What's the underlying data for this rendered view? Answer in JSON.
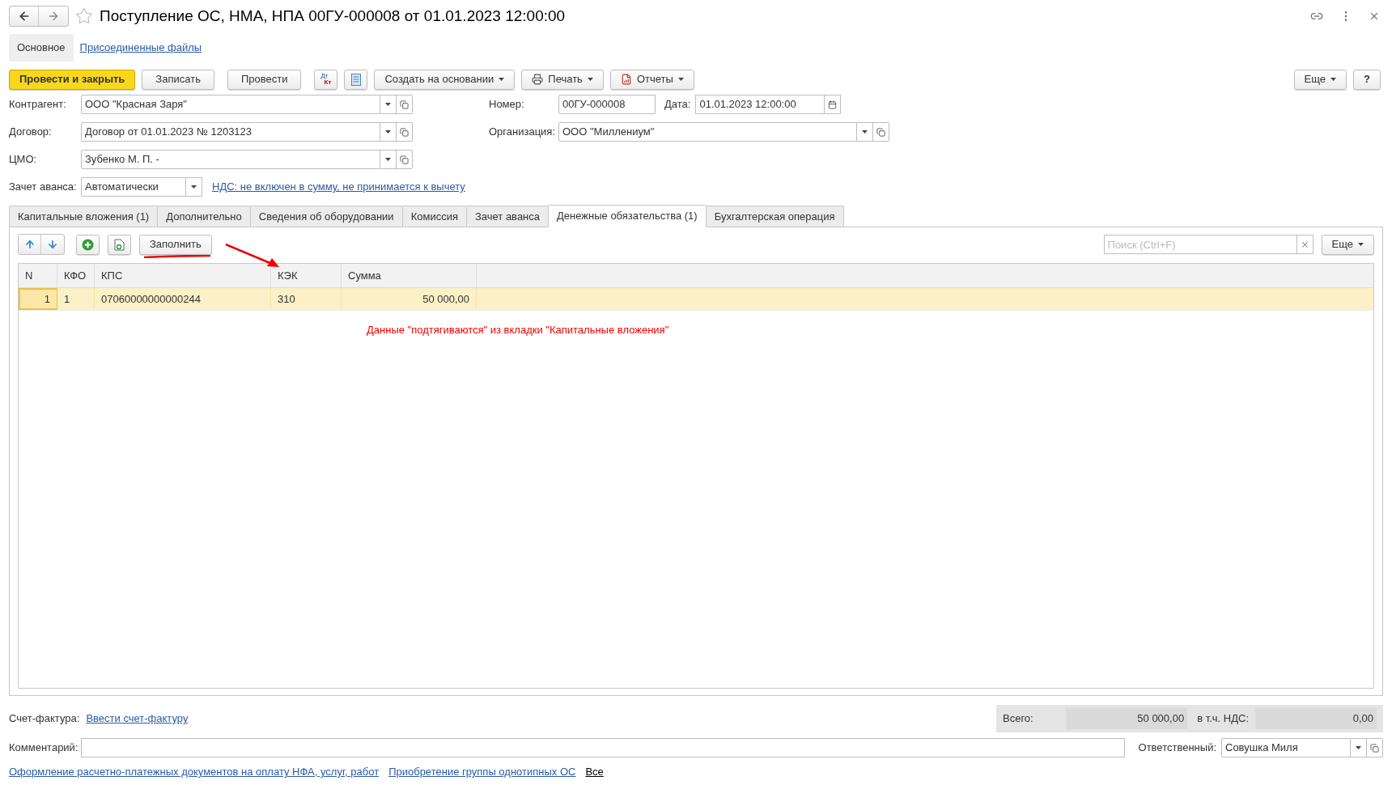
{
  "window": {
    "title": "Поступление ОС, НМА, НПА 00ГУ-000008 от 01.01.2023 12:00:00"
  },
  "sections": [
    {
      "label": "Основное",
      "selected": true
    },
    {
      "label": "Присоединенные файлы",
      "selected": false
    }
  ],
  "toolbar": [
    {
      "kind": "primary",
      "label": "Провести и закрыть"
    },
    {
      "kind": "plain",
      "label": "Записать"
    },
    {
      "kind": "plain",
      "label": "Провести"
    },
    {
      "kind": "dtkt",
      "top": "Дт",
      "bottom": "Кт"
    },
    {
      "kind": "list"
    },
    {
      "kind": "menu",
      "label": "Создать на основании"
    },
    {
      "kind": "print",
      "label": "Печать"
    },
    {
      "kind": "reports",
      "label": "Отчеты"
    }
  ],
  "toolbar_right": {
    "more": "Еще",
    "help": "?"
  },
  "left_fields": [
    {
      "label": "Контрагент:",
      "value": "ООО \"Красная Заря\""
    },
    {
      "label": "Договор:",
      "value": "Договор от 01.01.2023 № 1203123"
    },
    {
      "label": "ЦМО:",
      "value": "Зубенко М. П. -"
    }
  ],
  "number": {
    "label": "Номер:",
    "value": "00ГУ-000008"
  },
  "date": {
    "label": "Дата:",
    "value": "01.01.2023 12:00:00"
  },
  "organization": {
    "label": "Организация:",
    "value": "ООО \"Миллениум\""
  },
  "advance": {
    "label": "Зачет аванса:",
    "value": "Автоматически",
    "vat_link": "НДС: не включен в сумму, не принимается к вычету"
  },
  "tabs": [
    {
      "label": "Капитальные вложения (1)",
      "selected": false
    },
    {
      "label": "Дополнительно",
      "selected": false
    },
    {
      "label": "Сведения об оборудовании",
      "selected": false
    },
    {
      "label": "Комиссия",
      "selected": false
    },
    {
      "label": "Зачет аванса",
      "selected": false
    },
    {
      "label": "Денежные обязательства (1)",
      "selected": true
    },
    {
      "label": "Бухгалтерская операция",
      "selected": false
    }
  ],
  "table_toolbar": {
    "fill": "Заполнить",
    "search": {
      "placeholder": "Поиск (Ctrl+F)"
    },
    "more": "Еще"
  },
  "table": {
    "columns": [
      "N",
      "КФО",
      "КПС",
      "КЭК",
      "Сумма"
    ],
    "rows": [
      {
        "selected": true,
        "cells": [
          "1",
          "1",
          "07060000000000244",
          "310",
          "50 000,00"
        ]
      }
    ]
  },
  "annotation": "Данные \"подтягиваются\" из вкладки \"Капитальные вложения\"",
  "invoice": {
    "label": "Счет-фактура:",
    "link": "Ввести счет-фактуру"
  },
  "totals": {
    "total_label": "Всего:",
    "total": "50 000,00",
    "vat_label": "в т.ч. НДС:",
    "vat": "0,00"
  },
  "comment": {
    "label": "Комментарий:"
  },
  "responsible": {
    "label": "Ответственный:",
    "value": "Совушка Миля"
  },
  "footer_links": [
    {
      "label": "Оформление расчетно-платежных документов на оплату НФА, услуг, работ",
      "kind": "link"
    },
    {
      "label": "Приобретение группы однотипных ОС",
      "kind": "link"
    },
    {
      "label": "Все",
      "kind": "all"
    }
  ]
}
